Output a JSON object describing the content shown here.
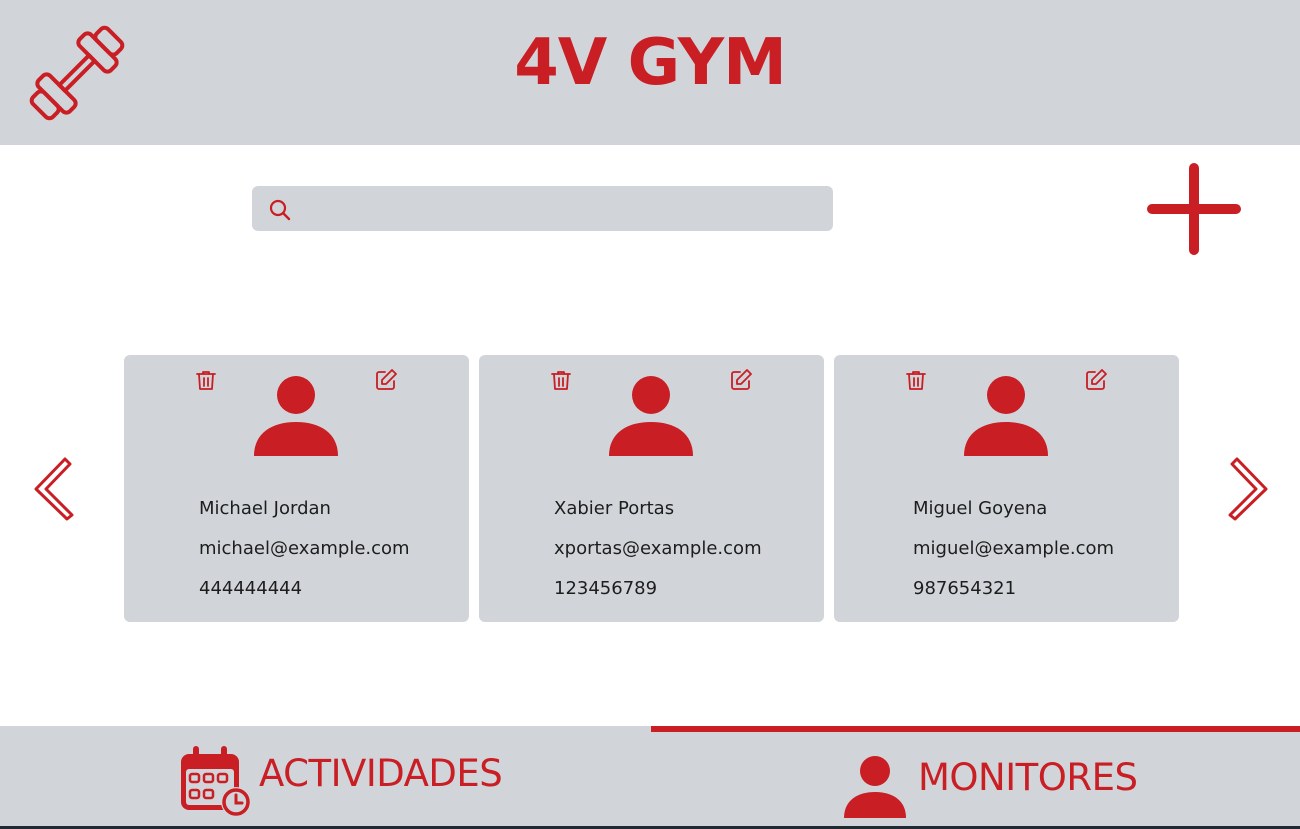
{
  "header": {
    "title": "4V GYM",
    "logo_icon": "dumbbell-icon"
  },
  "search": {
    "placeholder": "",
    "value": "",
    "icon": "search-icon"
  },
  "actions": {
    "add_icon": "plus-icon"
  },
  "carousel": {
    "prev_icon": "chevron-left-icon",
    "next_icon": "chevron-right-icon",
    "cards": [
      {
        "name": "Michael Jordan",
        "email": "michael@example.com",
        "phone": "444444444"
      },
      {
        "name": "Xabier Portas",
        "email": "xportas@example.com",
        "phone": "123456789"
      },
      {
        "name": "Miguel Goyena",
        "email": "miguel@example.com",
        "phone": "987654321"
      }
    ]
  },
  "tabs": [
    {
      "label": "ACTIVIDADES",
      "icon": "calendar-clock-icon",
      "active": false
    },
    {
      "label": "MONITORES",
      "icon": "user-icon",
      "active": true
    }
  ],
  "colors": {
    "accent": "#c81e24",
    "panel": "#d1d5d9",
    "background": "#ffffff",
    "text": "#1d1d1d"
  }
}
